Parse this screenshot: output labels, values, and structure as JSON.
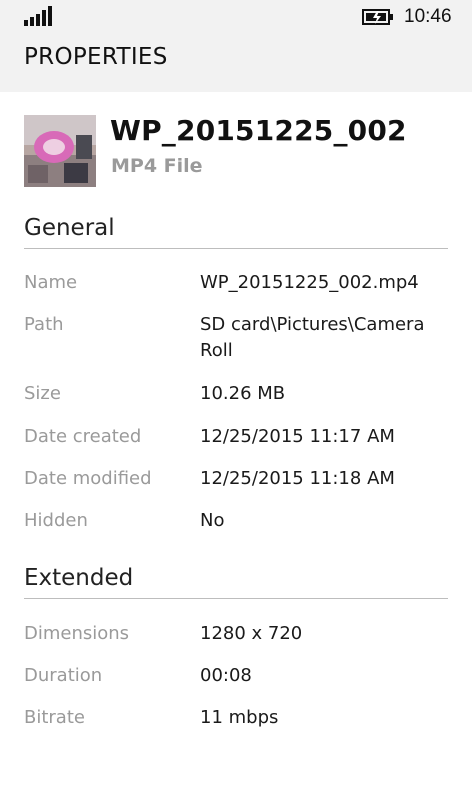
{
  "status": {
    "time": "10:46",
    "signal_icon": "signal-bars-icon",
    "battery_icon": "battery-charging-icon"
  },
  "header": {
    "title": "PROPERTIES"
  },
  "file": {
    "name": "WP_20151225_002",
    "type": "MP4 File",
    "thumbnail_icon": "video-thumbnail"
  },
  "general": {
    "title": "General",
    "rows": [
      {
        "label": "Name",
        "value": "WP_20151225_002.mp4"
      },
      {
        "label": "Path",
        "value": "SD card\\Pictures\\Camera Roll"
      },
      {
        "label": "Size",
        "value": "10.26 MB"
      },
      {
        "label": "Date created",
        "value": "12/25/2015 11:17 AM"
      },
      {
        "label": "Date modified",
        "value": "12/25/2015 11:18 AM"
      },
      {
        "label": "Hidden",
        "value": "No"
      }
    ]
  },
  "extended": {
    "title": "Extended",
    "rows": [
      {
        "label": "Dimensions",
        "value": "1280 x 720"
      },
      {
        "label": "Duration",
        "value": "00:08"
      },
      {
        "label": "Bitrate",
        "value": "11 mbps"
      }
    ]
  }
}
